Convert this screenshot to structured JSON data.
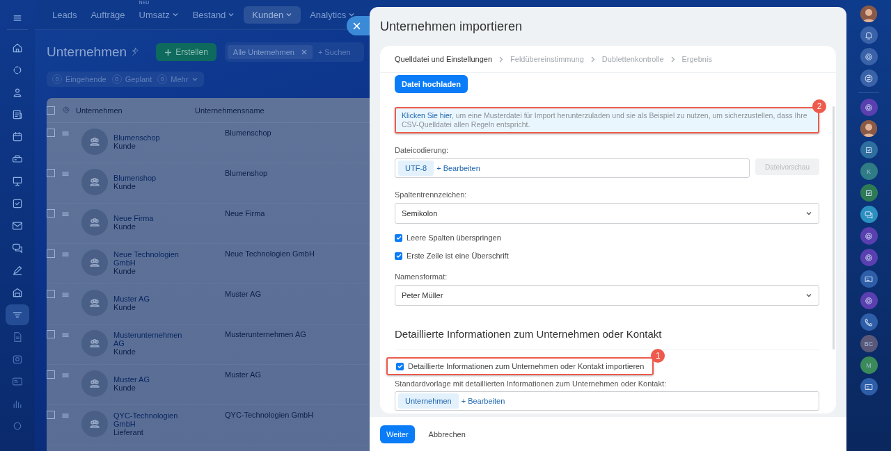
{
  "left_nav": {
    "items": [
      {
        "selected": false
      },
      {
        "selected": false
      },
      {
        "selected": false
      },
      {
        "selected": false
      },
      {
        "selected": false
      },
      {
        "selected": false
      },
      {
        "selected": false
      },
      {
        "selected": false
      },
      {
        "selected": false
      },
      {
        "selected": false
      },
      {
        "selected": false
      },
      {
        "selected": false
      },
      {
        "selected": true
      },
      {
        "selected": false
      },
      {
        "selected": false
      },
      {
        "selected": false
      },
      {
        "selected": false
      },
      {
        "selected": false
      }
    ]
  },
  "top_nav": [
    {
      "label": "Leads",
      "selected": false,
      "dropdown": false
    },
    {
      "label": "Aufträge",
      "selected": false,
      "dropdown": false
    },
    {
      "label": "Umsatz",
      "selected": false,
      "dropdown": true,
      "badge": "NEU"
    },
    {
      "label": "Bestand",
      "selected": false,
      "dropdown": true
    },
    {
      "label": "Kunden",
      "selected": true,
      "dropdown": true
    },
    {
      "label": "Analytics",
      "selected": false,
      "dropdown": true
    }
  ],
  "page": {
    "title": "Unternehmen",
    "create_button": "Erstellen",
    "filter_tag": "Alle Unternehmen",
    "search_placeholder": "+ Suchen",
    "counters": [
      {
        "count": "0",
        "label": "Eingehende",
        "dropdown": false
      },
      {
        "count": "0",
        "label": "Geplant",
        "dropdown": false
      },
      {
        "count": "0",
        "label": "Mehr",
        "dropdown": true
      }
    ]
  },
  "table": {
    "columns": [
      "Unternehmen",
      "Unternehmensname"
    ],
    "all_checked": false,
    "rows": [
      {
        "name": "Blumenschop",
        "type": "Kunde",
        "company_name": "Blumenschop",
        "checked": false
      },
      {
        "name": "Blumenshop",
        "type": "Kunde",
        "company_name": "Blumenshop",
        "checked": false
      },
      {
        "name": "Neue Firma",
        "type": "Kunde",
        "company_name": "Neue Firma",
        "checked": false
      },
      {
        "name": "Neue Technologien GmbH",
        "type": "Kunde",
        "company_name": "Neue Technologien GmbH",
        "checked": false
      },
      {
        "name": "Muster AG",
        "type": "Kunde",
        "company_name": "Muster AG",
        "checked": false
      },
      {
        "name": "Musterunternehmen AG",
        "type": "Kunde",
        "company_name": "Musterunternehmen AG",
        "checked": false
      },
      {
        "name": "Muster AG",
        "type": "Kunde",
        "company_name": "Muster AG",
        "checked": false
      },
      {
        "name": "QYC-Technologien GmbH",
        "type": "Lieferant",
        "company_name": "QYC-Technologien GmbH",
        "checked": false
      }
    ]
  },
  "panel": {
    "title": "Unternehmen importieren",
    "steps": [
      {
        "label": "Quelldatei und Einstellungen",
        "selected": true
      },
      {
        "label": "Feldübereinstimmung",
        "selected": false
      },
      {
        "label": "Dublettenkontrolle",
        "selected": false
      },
      {
        "label": "Ergebnis",
        "selected": false
      }
    ],
    "upload_button": "Datei hochladen",
    "info": {
      "link": "Klicken Sie hier",
      "text": ", um eine Musterdatei für Import herunterzuladen und sie als Beispiel zu nutzen, um sicherzustellen, dass Ihre CSV-Quelldatei allen Regeln entspricht.",
      "annotation": "2"
    },
    "encoding": {
      "label": "Dateicodierung:",
      "value": "UTF-8",
      "edit": "+ Bearbeiten",
      "preview_button": {
        "label": "Dateivorschau",
        "disabled": true
      }
    },
    "separator": {
      "label": "Spaltentrennzeichen:",
      "value": "Semikolon"
    },
    "options": [
      {
        "label": "Leere Spalten überspringen",
        "checked": true
      },
      {
        "label": "Erste Zeile ist eine Überschrift",
        "checked": true
      }
    ],
    "name_format": {
      "label": "Namensformat:",
      "value": "Peter Müller"
    },
    "details_heading": "Detaillierte Informationen zum Unternehmen oder Kontakt",
    "details_option": {
      "label": "Detaillierte Informationen zum Unternehmen oder Kontakt importieren",
      "checked": true,
      "annotation": "1"
    },
    "template": {
      "label": "Standardvorlage mit detaillierten Informationen zum Unternehmen oder Kontakt:",
      "value": "Unternehmen",
      "edit": "+ Bearbeiten"
    },
    "footer": {
      "primary": "Weiter",
      "secondary": "Abbrechen"
    }
  },
  "right_rail": [
    {
      "kind": "avatar"
    },
    {
      "kind": "icon"
    },
    {
      "kind": "icon"
    },
    {
      "kind": "icon"
    },
    {
      "kind": "divider"
    },
    {
      "kind": "icon"
    },
    {
      "kind": "avatar"
    },
    {
      "kind": "icon"
    },
    {
      "kind": "initials",
      "text": "K",
      "color": "#2f7c84"
    },
    {
      "kind": "icon"
    },
    {
      "kind": "icon"
    },
    {
      "kind": "icon"
    },
    {
      "kind": "icon"
    },
    {
      "kind": "icon"
    },
    {
      "kind": "icon"
    },
    {
      "kind": "icon"
    },
    {
      "kind": "initials",
      "text": "BC",
      "color": "#5a5878"
    },
    {
      "kind": "initials",
      "text": "M",
      "color": "#3a8a5a"
    },
    {
      "kind": "icon"
    }
  ]
}
